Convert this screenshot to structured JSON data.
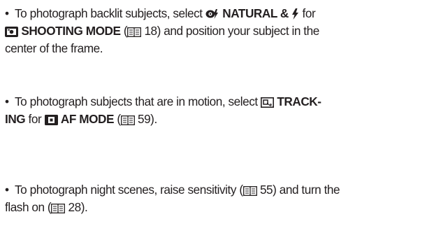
{
  "items": [
    {
      "bullet": "•",
      "line1_a": "To photograph backlit subjects, select",
      "natural_flash_label": "NATURAL &",
      "line1_b": "for",
      "shooting_mode_label": "SHOOTING MODE",
      "line2_ref_open": "(",
      "page_ref_1": "18) and position your subject in the",
      "line3": "center of the frame."
    },
    {
      "bullet": "•",
      "line1_a": "To photograph subjects that are in motion, select",
      "tracking_label_1": "TRACK-",
      "tracking_label_2": "ING",
      "for_text": "for",
      "af_mode_label": "AF MODE",
      "page_ref_open": "(",
      "page_ref": "59)."
    },
    {
      "bullet": "•",
      "line1_a": "To photograph night scenes, raise sensitivity (",
      "page_ref_a": "55) and turn the",
      "line2_a": "flash on (",
      "page_ref_b": "28)."
    }
  ],
  "icons": [
    "natural-mode-icon",
    "flash-icon",
    "camera-mode-icon",
    "page-reference-icon",
    "tracking-icon",
    "af-mode-icon"
  ]
}
